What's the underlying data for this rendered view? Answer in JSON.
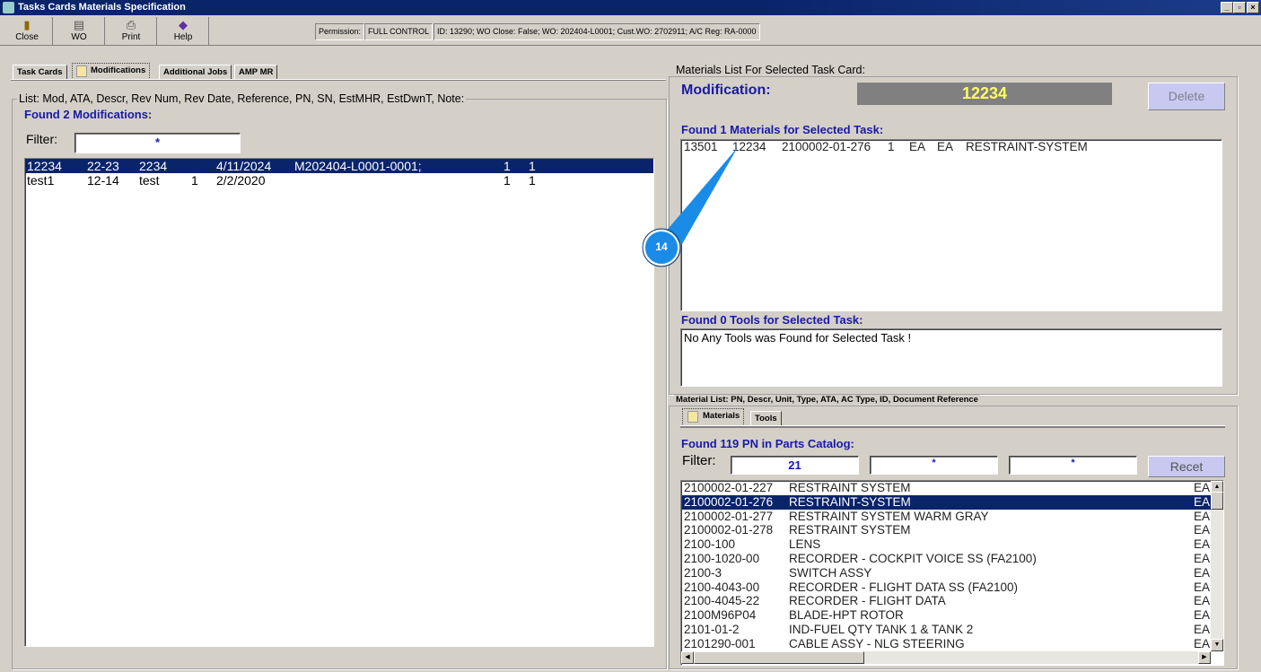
{
  "window": {
    "title": "Tasks Cards Materials Specification",
    "min": "_",
    "max": "▫",
    "close": "×"
  },
  "toolbar": {
    "close": "Close",
    "wo": "WO",
    "print": "Print",
    "help": "Help"
  },
  "info": {
    "permission_label": "Permission:",
    "permission_value": "FULL CONTROL",
    "details": "ID: 13290; WO Close: False; WO: 202404-L0001; Cust.WO: 2702911; A/C Reg: RA-0000"
  },
  "tabs": [
    "Task Cards",
    "Modifications",
    "Additional Jobs",
    "AMP MR"
  ],
  "left": {
    "group_label": "List: Mod, ATA, Descr, Rev Num, Rev Date, Reference, PN, SN, EstMHR, EstDwnT, Note:",
    "found": "Found 2 Modifications:",
    "filter_label": "Filter:",
    "filter_value": "*",
    "rows": [
      {
        "mod": "12234",
        "ata": "22-23",
        "descr": "2234",
        "rev": "",
        "date": "4/11/2024",
        "ref": "M202404-L0001-0001;",
        "mhr": "1",
        "dwn": "1"
      },
      {
        "mod": "test1",
        "ata": "12-14",
        "descr": "test",
        "rev": "1",
        "date": "2/2/2020",
        "ref": "",
        "mhr": "1",
        "dwn": "1"
      }
    ]
  },
  "right": {
    "group_label": "Materials List For Selected Task Card:",
    "mod_label": "Modification:",
    "mod_value": "12234",
    "delete": "Delete",
    "found_materials": "Found 1 Materials for Selected Task:",
    "materials": [
      {
        "id": "13501",
        "mod": "12234",
        "pn": "2100002-01-276",
        "qty": "1",
        "u1": "EA",
        "u2": "EA",
        "descr": "RESTRAINT-SYSTEM"
      }
    ],
    "found_tools": "Found 0 Tools for Selected Task:",
    "tools_text": "No Any Tools was Found for Selected Task !",
    "callout": "14"
  },
  "catalog": {
    "group_label": "Material List: PN, Descr, Unit, Type, ATA, AC Type, ID, Document Reference",
    "tabs": [
      "Materials",
      "Tools"
    ],
    "found": "Found 119 PN in Parts Catalog:",
    "filter_label": "Filter:",
    "filter1": "21",
    "filter2": "*",
    "filter3": "*",
    "reset": "Recet",
    "rows": [
      {
        "pn": "2100002-01-227",
        "descr": "RESTRAINT SYSTEM",
        "unit": "EA"
      },
      {
        "pn": "2100002-01-276",
        "descr": "RESTRAINT-SYSTEM",
        "unit": "EA"
      },
      {
        "pn": "2100002-01-277",
        "descr": "RESTRAINT SYSTEM WARM GRAY",
        "unit": "EA"
      },
      {
        "pn": "2100002-01-278",
        "descr": "RESTRAINT SYSTEM",
        "unit": "EA"
      },
      {
        "pn": "2100-100",
        "descr": "LENS",
        "unit": "EA"
      },
      {
        "pn": "2100-1020-00",
        "descr": "RECORDER - COCKPIT VOICE SS (FA2100)",
        "unit": "EA"
      },
      {
        "pn": "2100-3",
        "descr": "SWITCH ASSY",
        "unit": "EA"
      },
      {
        "pn": "2100-4043-00",
        "descr": "RECORDER - FLIGHT DATA SS (FA2100)",
        "unit": "EA"
      },
      {
        "pn": "2100-4045-22",
        "descr": "RECORDER - FLIGHT DATA",
        "unit": "EA"
      },
      {
        "pn": "2100M96P04",
        "descr": "BLADE-HPT ROTOR",
        "unit": "EA"
      },
      {
        "pn": "2101-01-2",
        "descr": "IND-FUEL QTY TANK 1 & TANK 2",
        "unit": "EA"
      },
      {
        "pn": "2101290-001",
        "descr": "CABLE ASSY - NLG STEERING",
        "unit": "EA"
      }
    ]
  }
}
